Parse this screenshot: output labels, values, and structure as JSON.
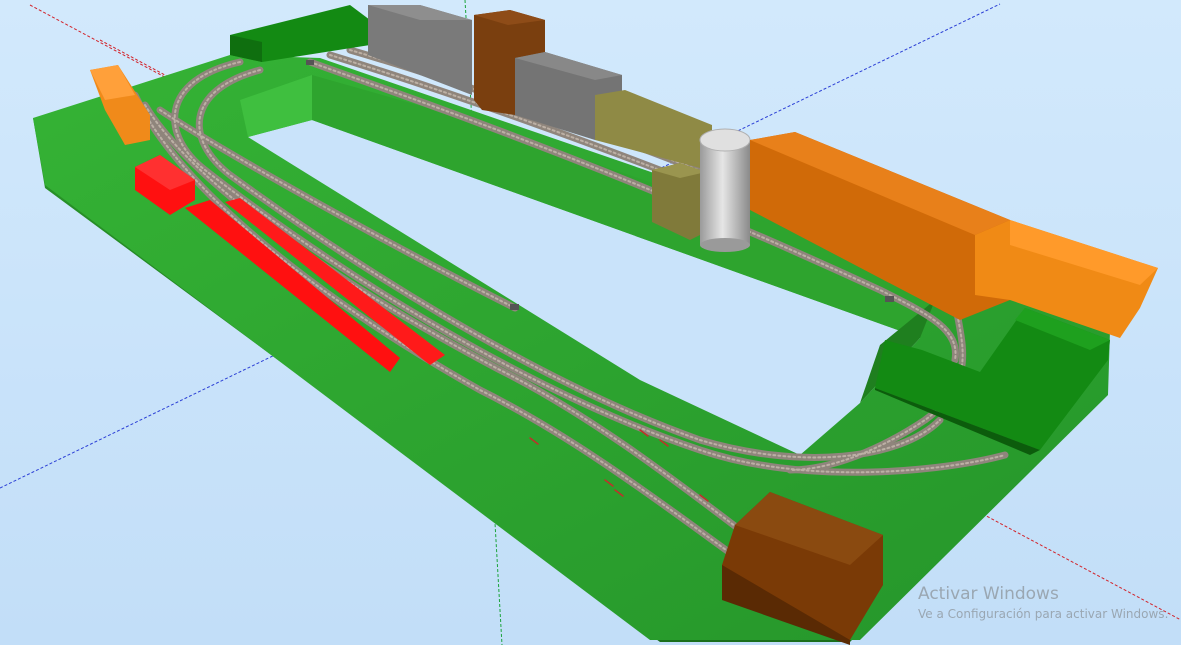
{
  "viewport": {
    "background": "#c6e2fa",
    "axis_colors": {
      "red": "#d2232a",
      "green": "#1aa33a",
      "blue": "#2b3fd6"
    }
  },
  "layout_board": {
    "board_color": "#2fa32f",
    "board_side_color": "#1e7a1e",
    "track_color": "#9a8f86",
    "rail_color": "#b0a49a"
  },
  "buildings": [
    {
      "id": "grey-warehouse-1",
      "color": "#7a7a7a"
    },
    {
      "id": "brown-tower",
      "color": "#7a3f0f"
    },
    {
      "id": "grey-warehouse-2",
      "color": "#747474"
    },
    {
      "id": "olive-shed",
      "color": "#8f8a45"
    },
    {
      "id": "silo",
      "color": "#c8c8c8"
    },
    {
      "id": "orange-factory",
      "color": "#e07a10"
    },
    {
      "id": "green-block-corner",
      "color": "#138a13"
    },
    {
      "id": "brown-station",
      "color": "#7a3a06"
    },
    {
      "id": "red-platform",
      "color": "#ff1010"
    },
    {
      "id": "orange-kiosk",
      "color": "#f08a1a"
    }
  ],
  "watermark": {
    "title": "Activar Windows",
    "subtitle": "Ve a Configuración para activar Windows."
  }
}
